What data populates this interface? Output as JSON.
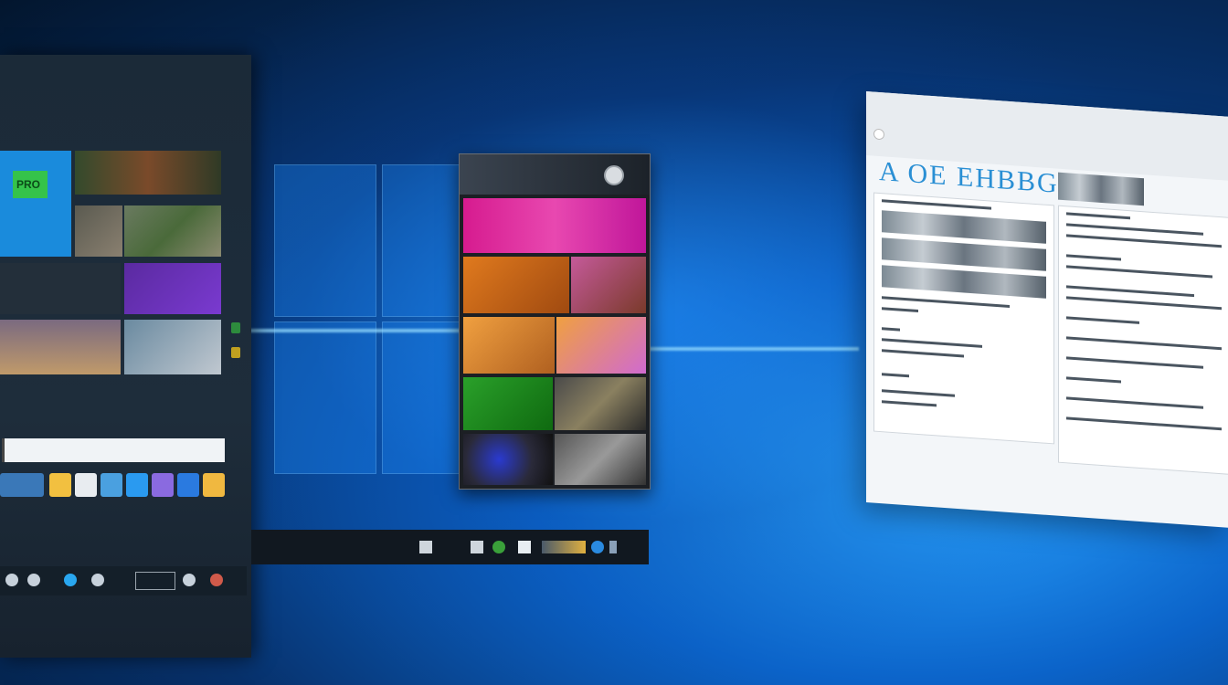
{
  "start_panel": {
    "tile_label": "PRO",
    "notification_text": "",
    "taskbar_items": []
  },
  "gallery_window": {
    "title": "",
    "cells": [
      {
        "colors": [
          "#d61b8f",
          "#8a2be2"
        ]
      },
      {
        "colors": [
          "#e07a1e",
          "#c55a9a"
        ]
      },
      {
        "colors": [
          "#f0a040",
          "#d06ad0"
        ]
      },
      {
        "colors": [
          "#2aa02a",
          "#4a4a4a"
        ]
      },
      {
        "colors": [
          "#2a3ad0",
          "#555555"
        ]
      }
    ]
  },
  "document_window": {
    "title": "A OE EHBBGIS"
  },
  "colors": {
    "accent": "#1a8bdc",
    "desktop": "#0b63c9"
  }
}
